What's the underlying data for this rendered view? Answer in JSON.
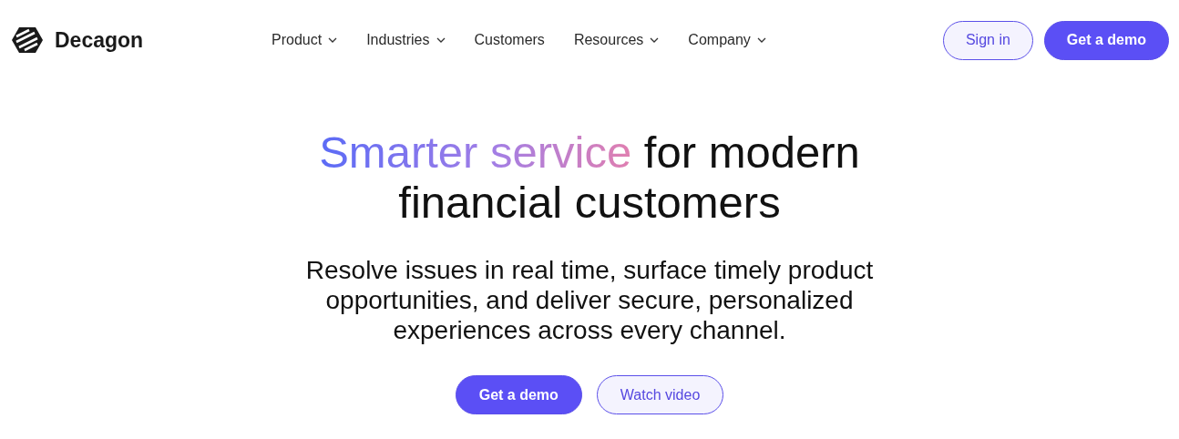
{
  "brand": {
    "name": "Decagon"
  },
  "nav": [
    {
      "label": "Product",
      "has_dropdown": true
    },
    {
      "label": "Industries",
      "has_dropdown": true
    },
    {
      "label": "Customers",
      "has_dropdown": false
    },
    {
      "label": "Resources",
      "has_dropdown": true
    },
    {
      "label": "Company",
      "has_dropdown": true
    }
  ],
  "header_buttons": [
    {
      "label": "Sign in",
      "kind": "secondary"
    },
    {
      "label": "Get a demo",
      "kind": "primary"
    }
  ],
  "hero": {
    "headline_highlight": "Smarter service",
    "headline_rest": "for modern financial customers",
    "subtitle": "Resolve issues in real time, surface timely product opportunities, and deliver secure, personalized experiences across every channel.",
    "buttons": [
      {
        "label": "Get a demo",
        "kind": "primary"
      },
      {
        "label": "Watch video",
        "kind": "secondary"
      }
    ]
  }
}
